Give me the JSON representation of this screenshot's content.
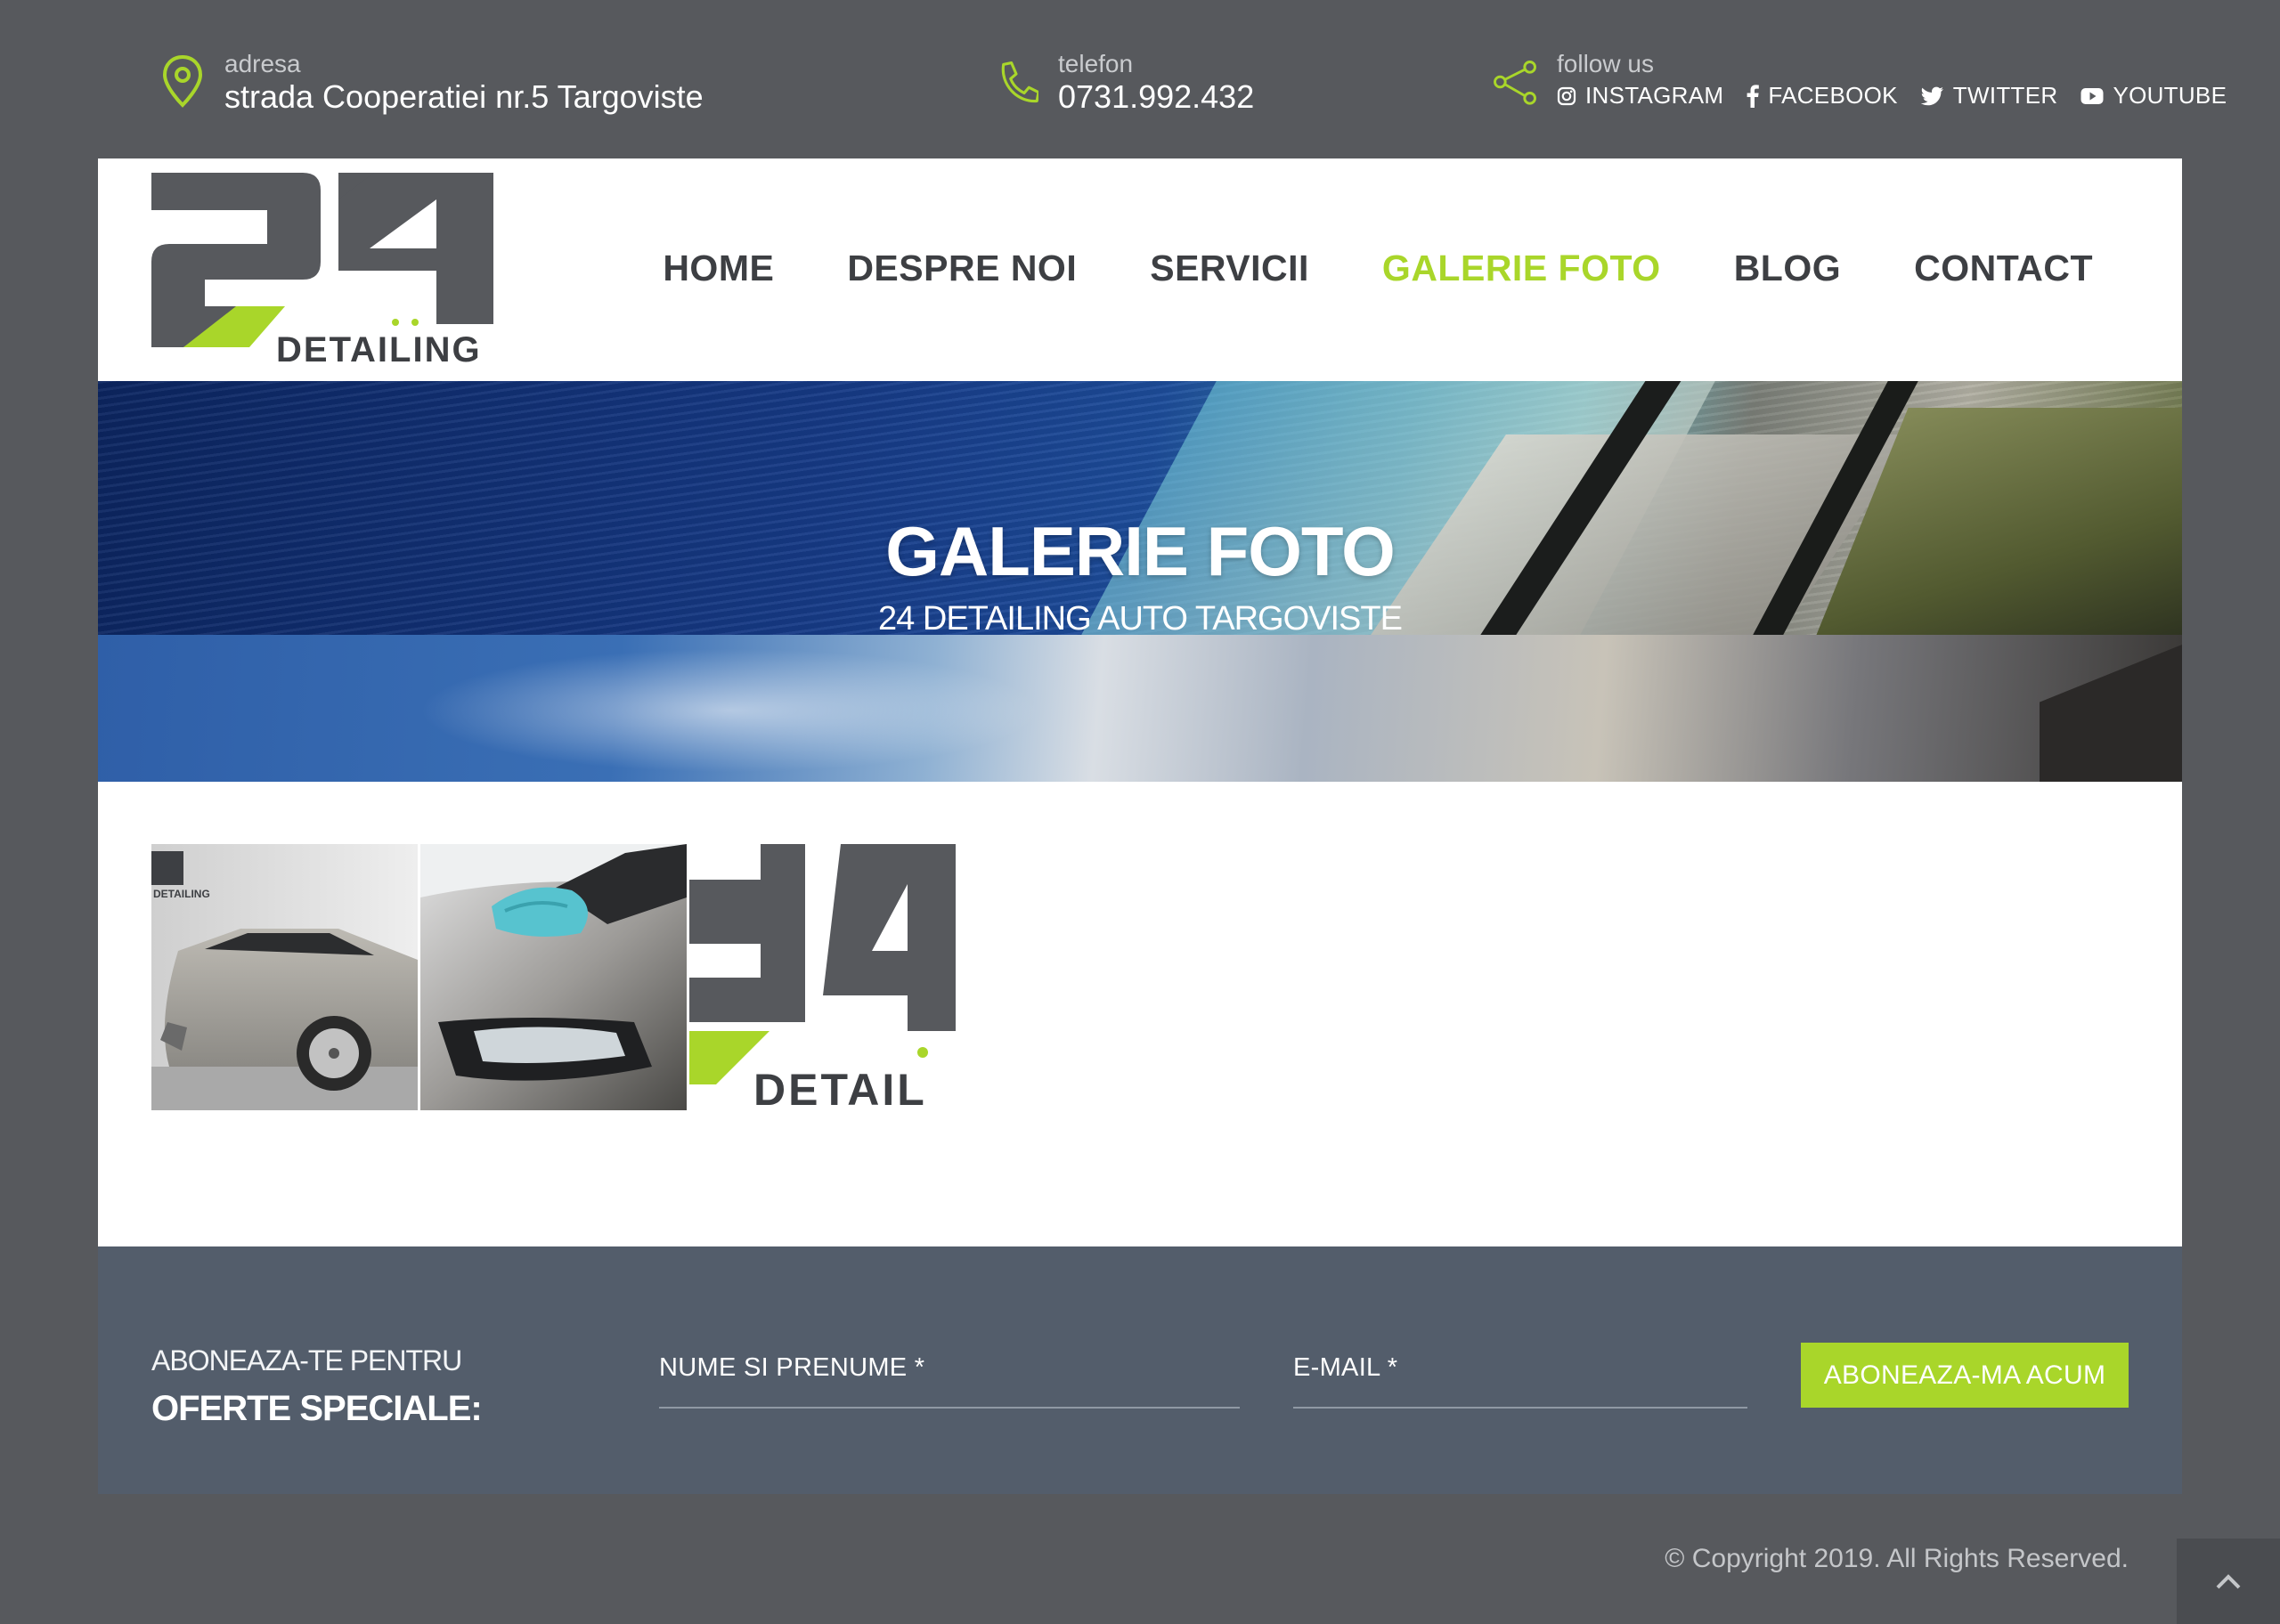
{
  "topbar": {
    "address": {
      "label": "adresa",
      "value": "strada Cooperatiei nr.5 Targoviste",
      "icon": "map-pin-icon"
    },
    "phone": {
      "label": "telefon",
      "value": "0731.992.432",
      "icon": "phone-icon"
    },
    "follow": {
      "label": "follow us",
      "icon": "share-icon",
      "links": [
        {
          "label": "INSTAGRAM",
          "icon": "instagram-icon"
        },
        {
          "label": "FACEBOOK",
          "icon": "facebook-icon"
        },
        {
          "label": "TWITTER",
          "icon": "twitter-icon"
        },
        {
          "label": "YOUTUBE",
          "icon": "youtube-icon"
        }
      ]
    }
  },
  "logo": {
    "number": "24",
    "word": "DETAILING"
  },
  "nav": {
    "items": [
      {
        "label": "HOME"
      },
      {
        "label": "DESPRE NOI"
      },
      {
        "label": "SERVICII"
      },
      {
        "label": "GALERIE FOTO",
        "active": true
      },
      {
        "label": "BLOG"
      },
      {
        "label": "CONTACT"
      }
    ]
  },
  "hero": {
    "title": "GALERIE FOTO",
    "subtitle": "24 DETAILING AUTO TARGOVISTE"
  },
  "gallery": {
    "thumbs": [
      {
        "subject": "silver car in showroom"
      },
      {
        "subject": "gloved hand polishing headlight"
      },
      {
        "subject": "24 detailing logo",
        "text": "DETAIL"
      }
    ]
  },
  "subscribe": {
    "pre": "ABONEAZA-TE PENTRU",
    "main": "OFERTE SPECIALE:",
    "name_placeholder": "NUME SI PRENUME *",
    "email_placeholder": "E-MAIL *",
    "button": "ABONEAZA-MA ACUM"
  },
  "footer": {
    "copyright": "© Copyright 2019. All Rights Reserved."
  },
  "colors": {
    "accent": "#a9d62a",
    "dark": "#3d3f43",
    "background": "#57595d",
    "subscribe_bg": "#535d6b"
  }
}
